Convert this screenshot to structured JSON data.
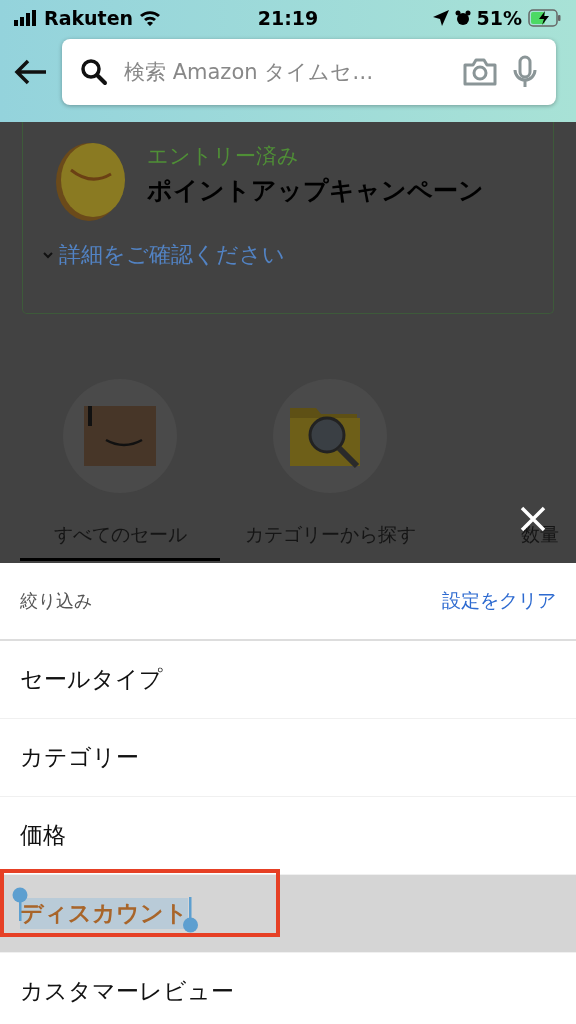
{
  "status_bar": {
    "carrier": "Rakuten",
    "time": "21:19",
    "battery": "51%"
  },
  "search": {
    "placeholder": "検索 Amazon タイムセ…"
  },
  "campaign": {
    "status": "エントリー済み",
    "title": "ポイントアップキャンペーン",
    "link": "詳細をご確認ください"
  },
  "tabs": [
    {
      "label": "すべてのセール",
      "selected": true
    },
    {
      "label": "カテゴリーから探す",
      "selected": false
    },
    {
      "label": "数量",
      "selected": false
    }
  ],
  "filter_sheet": {
    "title": "絞り込み",
    "clear": "設定をクリア",
    "items": [
      {
        "label": "セールタイプ",
        "selected": false
      },
      {
        "label": "カテゴリー",
        "selected": false
      },
      {
        "label": "価格",
        "selected": false
      },
      {
        "label": "ディスカウント",
        "selected": true
      },
      {
        "label": "カスタマーレビュー",
        "selected": false
      }
    ]
  }
}
